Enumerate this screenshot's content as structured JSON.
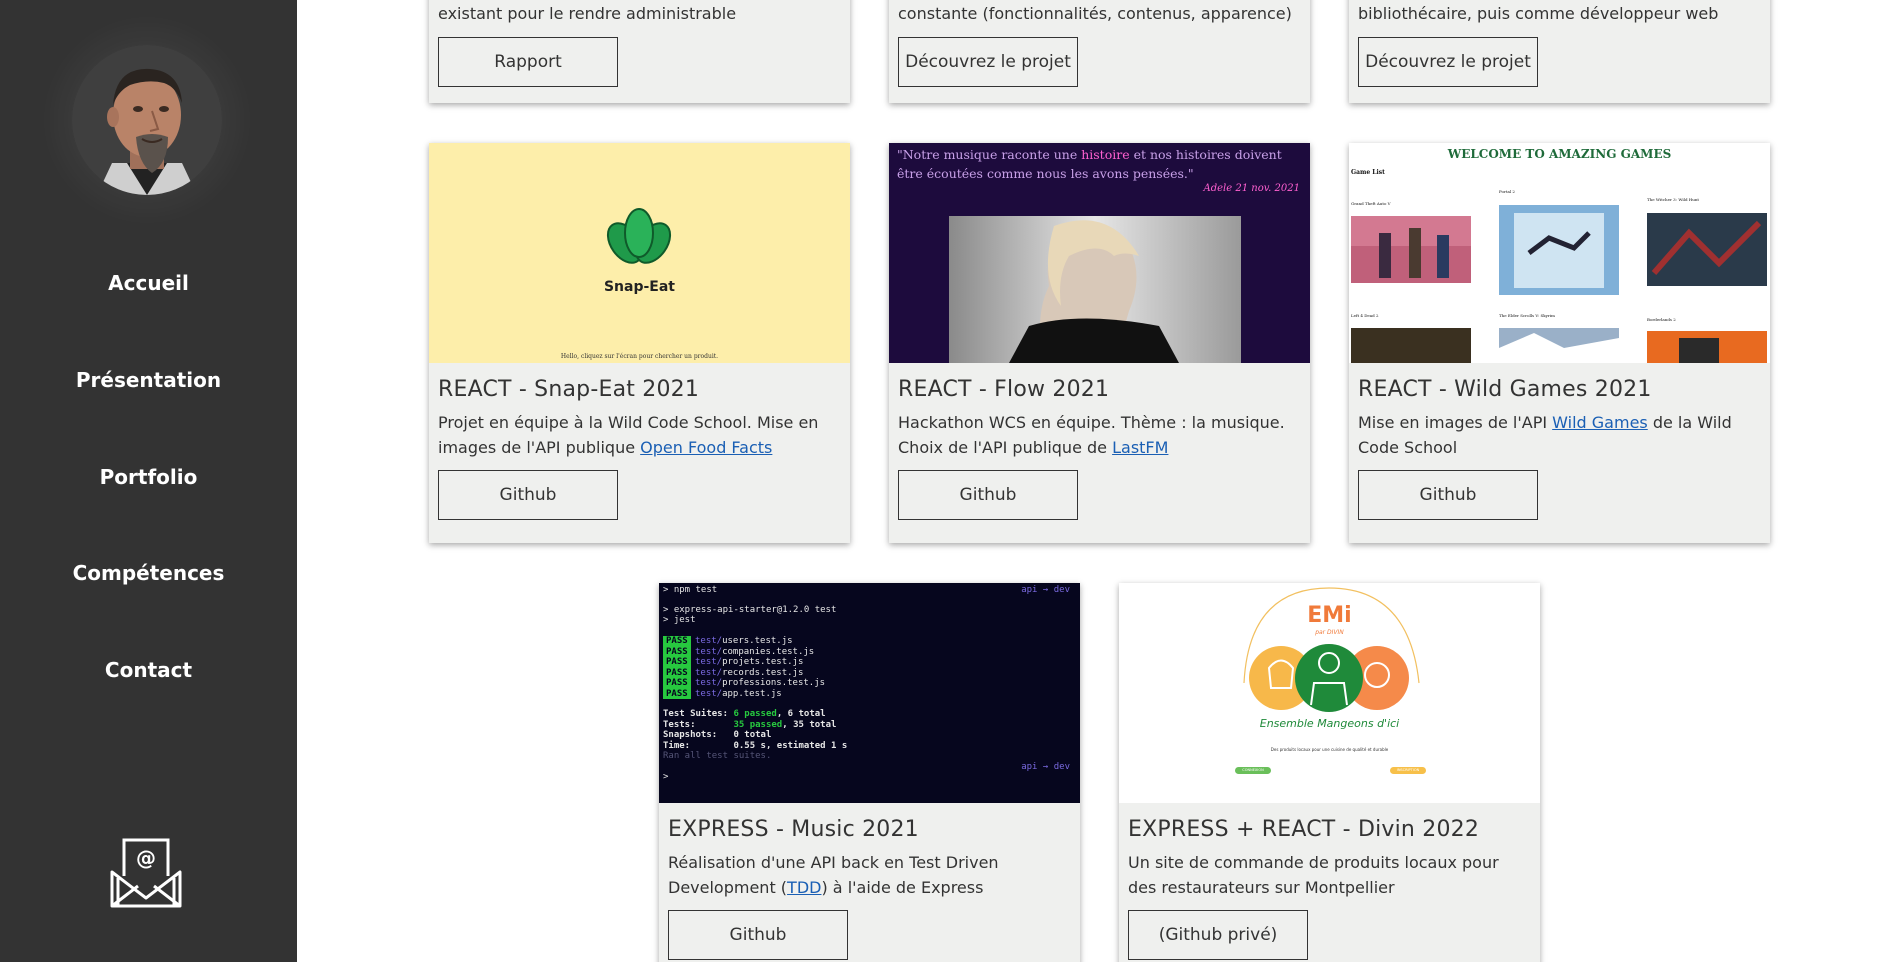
{
  "sidebar": {
    "nav": [
      "Accueil",
      "Présentation",
      "Portfolio",
      "Compétences",
      "Contact"
    ]
  },
  "top_cards": [
    {
      "text": "existant pour le rendre administrable",
      "button": "Rapport"
    },
    {
      "text": "constante (fonctionnalités, contenus, apparence)",
      "button": "Découvrez le projet"
    },
    {
      "text": "bibliothécaire, puis comme développeur web",
      "button": "Découvrez le projet"
    }
  ],
  "cards": [
    {
      "title": "REACT - Snap-Eat 2021",
      "desc_before": "Projet en équipe à la Wild Code School. Mise en images de l'API publique ",
      "link": "Open Food Facts",
      "desc_after": "",
      "button": "Github",
      "thumb": {
        "logo_text": "Snap-Eat",
        "footer": "Hello, cliquez sur l'écran pour chercher un produit."
      }
    },
    {
      "title": "REACT - Flow 2021",
      "desc_before": "Hackathon WCS en équipe. Thème : la musique. Choix de l'API publique de ",
      "link": "LastFM",
      "desc_after": "",
      "button": "Github",
      "thumb": {
        "quote_1": "\"Notre musique raconte une ",
        "quote_hl": "histoire",
        "quote_2": " et nos histoires doivent être écoutées comme nous les avons pensées.\"",
        "author": "Adele 21 nov. 2021"
      }
    },
    {
      "title": "REACT - Wild Games 2021",
      "desc_before": "Mise en images de l'API ",
      "link": "Wild Games",
      "desc_after": " de la Wild Code School",
      "button": "Github",
      "thumb": {
        "heading": "WELCOME TO AMAZING GAMES",
        "sub": "Game List",
        "games": [
          "Grand Theft Auto V",
          "Portal 2",
          "The Witcher 3: Wild Hunt",
          "Left 4 Dead 2",
          "The Elder Scrolls V: Skyrim",
          "Borderlands 2"
        ]
      }
    },
    {
      "title": "EXPRESS - Music 2021",
      "desc_before": "Réalisation d'une API back en Test Driven Development (",
      "link": "TDD",
      "desc_after": ") à l'aide de Express",
      "button": "Github",
      "thumb": {
        "prompt": "> npm test",
        "branch": "api → dev",
        "lines": [
          "> express-api-starter@1.2.0 test",
          "> jest"
        ],
        "tests": [
          "users.test.js",
          "companies.test.js",
          "projets.test.js",
          "records.test.js",
          "professions.test.js",
          "app.test.js"
        ],
        "pass": "PASS",
        "summary": [
          [
            "Test Suites:",
            "6 passed",
            ", 6 total"
          ],
          [
            "Tests:",
            "35 passed",
            ", 35 total"
          ],
          [
            "Snapshots:",
            "",
            "0 total"
          ],
          [
            "Time:",
            "",
            "0.55 s, estimated 1 s"
          ]
        ],
        "ran": "Ran all test suites."
      }
    },
    {
      "title": "EXPRESS + REACT - Divin 2022",
      "desc_before": "Un site de commande de produits locaux pour des restaurateurs sur Montpellier",
      "link": "",
      "desc_after": "",
      "button": "(Github privé)",
      "thumb": {
        "brand": "EMi",
        "brand_sub": "par DIVIN",
        "tagline": "Ensemble Mangeons d'ici",
        "small": "Des produits locaux pour une cuisine de qualité et durable",
        "btn1": "CONNEXION",
        "btn2": "INSCRIPTION"
      }
    }
  ],
  "colors": {
    "sidebar": "#333333",
    "card": "#eff0ee",
    "link": "#1a5fb4",
    "snap_bg": "#fdeeaa",
    "flow_bg": "#1d0b3d"
  }
}
